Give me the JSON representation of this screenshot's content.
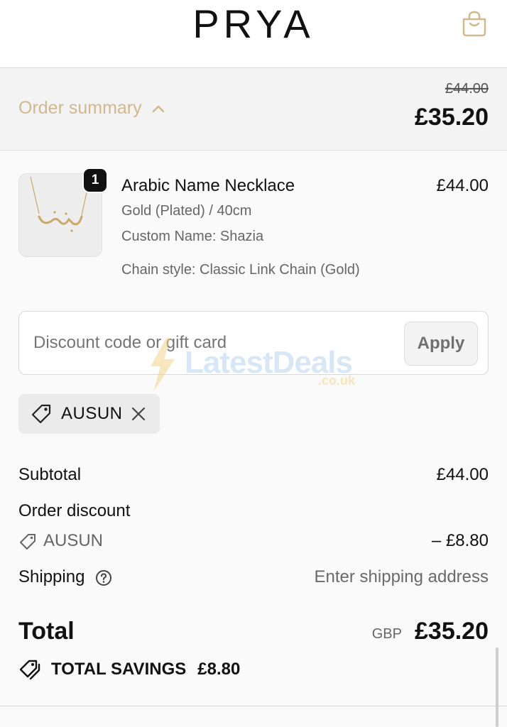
{
  "header": {
    "logo": "PRYA",
    "bag_icon": "shopping-bag-icon"
  },
  "order_summary": {
    "toggle_label": "Order summary",
    "chevron_icon": "chevron-up-icon",
    "original_total": "£44.00",
    "total": "£35.20",
    "accent_color": "#d1b98d"
  },
  "product": {
    "quantity": "1",
    "title": "Arabic Name Necklace",
    "price": "£44.00",
    "variant": "Gold (Plated) / 40cm",
    "custom_name": "Custom Name: Shazia",
    "chain_style": "Chain style: Classic Link Chain (Gold)"
  },
  "discount": {
    "placeholder": "Discount code or gift card",
    "value": "",
    "apply_label": "Apply"
  },
  "watermark": {
    "text": "LatestDeals",
    "sub": ".co.uk"
  },
  "applied_code": {
    "code": "AUSUN",
    "tag_icon": "tag-icon",
    "remove_icon": "close-icon"
  },
  "totals": {
    "subtotal_label": "Subtotal",
    "subtotal_value": "£44.00",
    "order_discount_label": "Order discount",
    "discount_code": "AUSUN",
    "discount_value": "– £8.80",
    "shipping_label": "Shipping",
    "shipping_value": "Enter shipping address",
    "total_label": "Total",
    "currency": "GBP",
    "total_value": "£35.20",
    "savings_label": "TOTAL SAVINGS",
    "savings_value": "£8.80"
  }
}
